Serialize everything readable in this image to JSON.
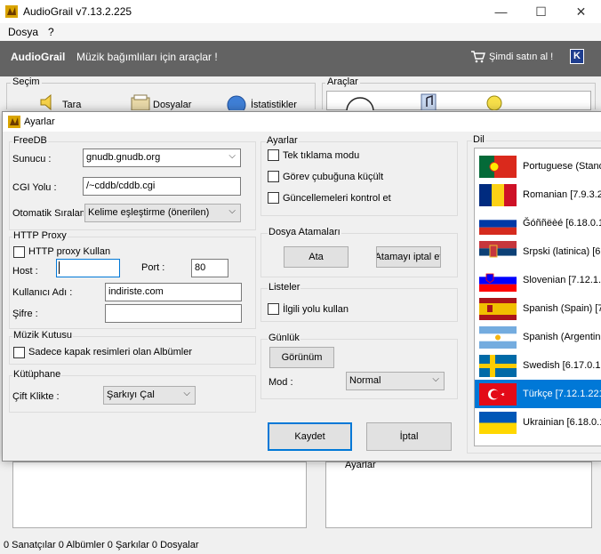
{
  "window": {
    "title": "AudioGrail v7.13.2.225"
  },
  "menu": {
    "items": [
      "Dosya",
      "?"
    ]
  },
  "banner": {
    "brand": "AudioGrail",
    "tagline": "Müzik bağımlıları için araçlar !",
    "buy": "Şimdi satın al !",
    "k_label": "K"
  },
  "background": {
    "secim_label": "Seçim",
    "araclar_label": "Araçlar",
    "tara": "Tara",
    "dosyalar": "Dosyalar",
    "istatistikler": "İstatistikler",
    "araclar_lower": "Ayarlar"
  },
  "status": "0 Sanatçılar 0 Albümler 0 Şarkılar 0 Dosyalar",
  "dialog": {
    "title": "Ayarlar",
    "freedb": {
      "label": "FreeDB",
      "server_label": "Sunucu :",
      "server_value": "gnudb.gnudb.org",
      "cgi_label": "CGI Yolu :",
      "cgi_value": "/~cddb/cddb.cgi",
      "sort_label": "Otomatik Sıralama",
      "sort_value": "Kelime eşleştirme (önerilen)"
    },
    "proxy": {
      "label": "HTTP Proxy",
      "use_label": "HTTP proxy Kullan",
      "host_label": "Host :",
      "host_value": "",
      "port_label": "Port :",
      "port_value": "80",
      "user_label": "Kullanıcı Adı :",
      "user_value": "indiriste.com",
      "pass_label": "Şifre :",
      "pass_value": ""
    },
    "musicbox": {
      "label": "Müzik Kutusu",
      "only_covers_label": "Sadece kapak resimleri olan Albümler"
    },
    "library": {
      "label": "Kütüphane",
      "dblclick_label": "Çift Klikte  :",
      "dblclick_value": "Şarkıyı Çal"
    },
    "settings": {
      "label": "Ayarlar",
      "single_click": "Tek tıklama modu",
      "minimize_taskbar": "Görev çubuğuna küçült",
      "check_updates": "Güncellemeleri kontrol et"
    },
    "file_assoc": {
      "label": "Dosya Atamaları",
      "assign": "Ata",
      "unassign": "Atamayı iptal et"
    },
    "lists": {
      "label": "Listeler",
      "use_relative": "İlgili yolu kullan"
    },
    "log": {
      "label": "Günlük",
      "view": "Görünüm",
      "mode_label": "Mod :",
      "mode_value": "Normal"
    },
    "save": "Kaydet",
    "cancel": "İptal",
    "language": {
      "label": "Dil",
      "items": [
        {
          "name": "Portuguese (Standard)",
          "flag": "portugal"
        },
        {
          "name": "Romanian [7.9.3.2",
          "flag": "romania"
        },
        {
          "name": "Ğóññëèé [6.18.0.1",
          "flag": "russia"
        },
        {
          "name": "Srpski (latinica) [6.1",
          "flag": "serbia"
        },
        {
          "name": "Slovenian [7.12.1.2",
          "flag": "slovenia"
        },
        {
          "name": "Spanish (Spain) [7.",
          "flag": "spain"
        },
        {
          "name": "Spanish (Argentina",
          "flag": "argentina"
        },
        {
          "name": "Swedish [6.17.0.16",
          "flag": "sweden"
        },
        {
          "name": "Türkçe [7.12.1.221",
          "flag": "turkey"
        },
        {
          "name": "Ukrainian [6.18.0.1",
          "flag": "ukraine"
        }
      ],
      "selected_index": 8
    }
  }
}
